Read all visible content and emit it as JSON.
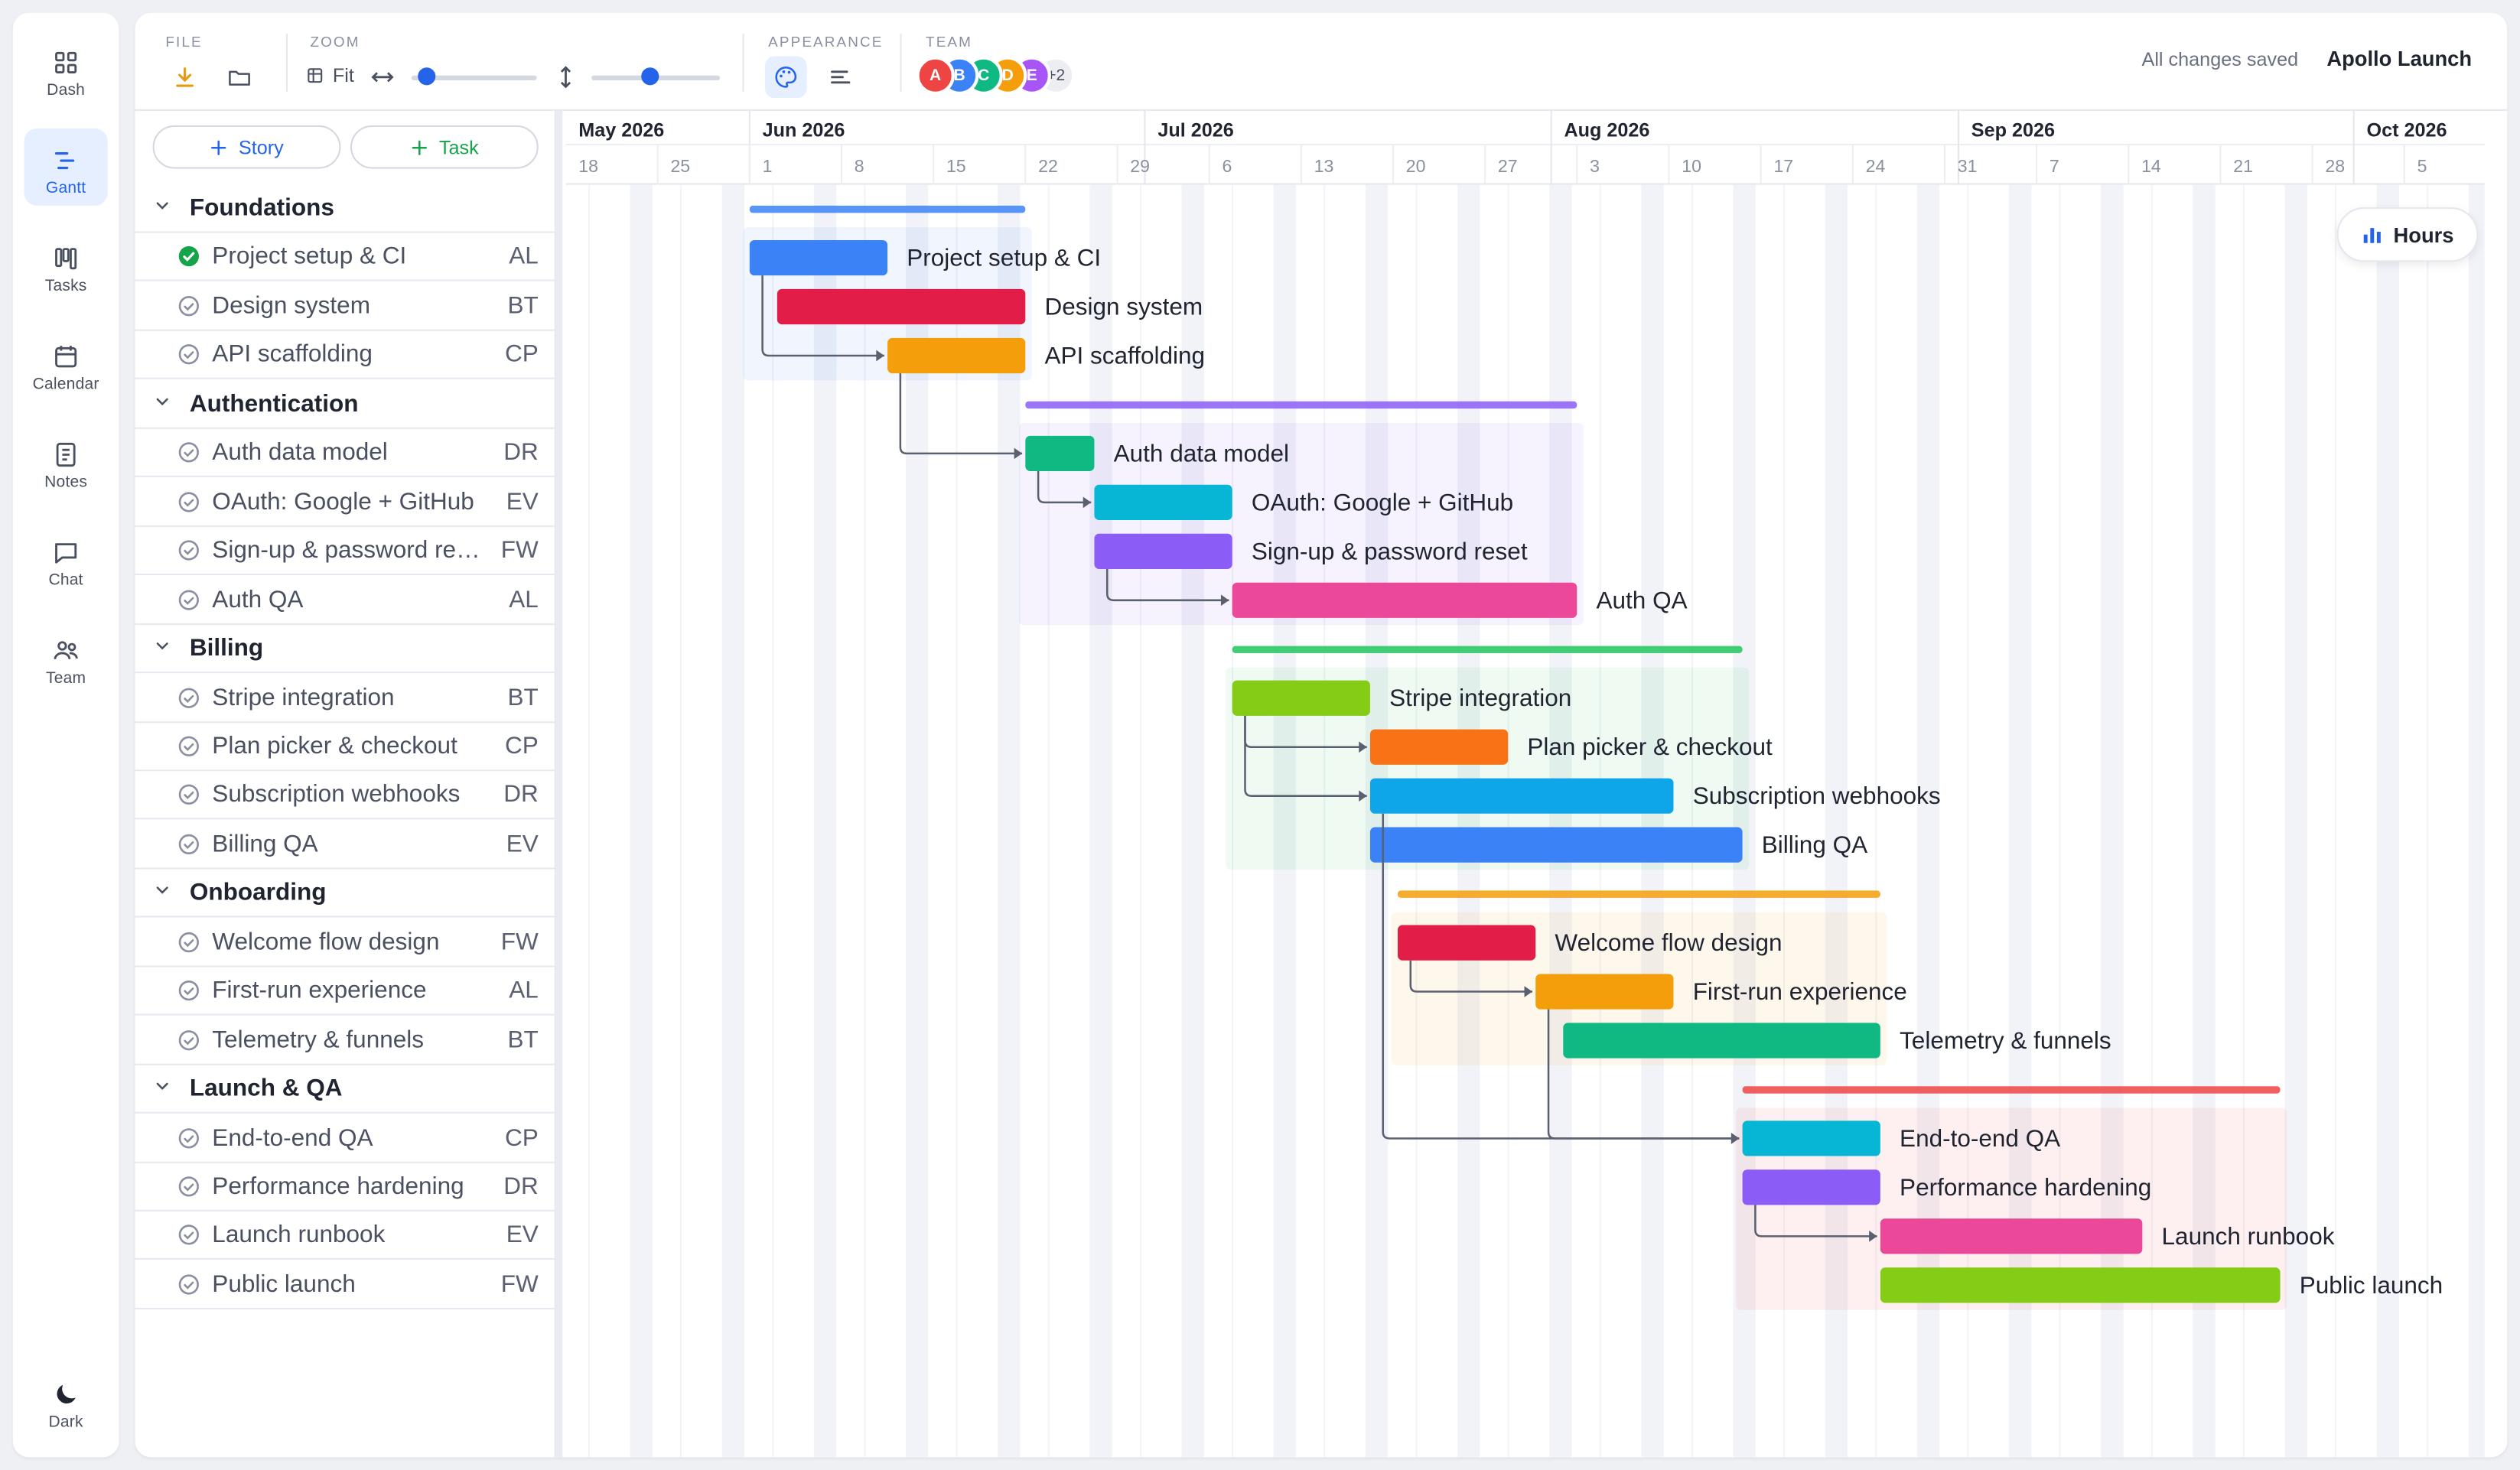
{
  "nav": [
    {
      "label": "Dash",
      "icon": "grid-icon",
      "active": false
    },
    {
      "label": "Gantt",
      "icon": "gantt-icon",
      "active": true
    },
    {
      "label": "Tasks",
      "icon": "kanban-icon",
      "active": false
    },
    {
      "label": "Calendar",
      "icon": "calendar-icon",
      "active": false
    },
    {
      "label": "Notes",
      "icon": "notes-icon",
      "active": false
    },
    {
      "label": "Chat",
      "icon": "chat-icon",
      "active": false
    },
    {
      "label": "Team",
      "icon": "team-icon",
      "active": false
    }
  ],
  "theme_toggle": {
    "label": "Dark",
    "icon": "moon-icon"
  },
  "toolbar": {
    "file_label": "FILE",
    "zoom_label": "ZOOM",
    "fit_label": "Fit",
    "appearance_label": "APPEARANCE",
    "team_label": "TEAM",
    "zoom_horizontal": 0.12,
    "zoom_vertical": 0.45,
    "team": [
      {
        "initial": "A",
        "color": "#ef4444"
      },
      {
        "initial": "B",
        "color": "#3b82f6"
      },
      {
        "initial": "C",
        "color": "#10b981"
      },
      {
        "initial": "D",
        "color": "#f59e0b"
      },
      {
        "initial": "E",
        "color": "#a855f7"
      }
    ],
    "team_more": "+2",
    "save_status": "All changes saved",
    "project_name": "Apollo Launch"
  },
  "list": {
    "add_story": "Story",
    "add_task": "Task"
  },
  "timeline": {
    "months": [
      "May 2026",
      "Jun 2026",
      "Jul 2026",
      "Aug 2026",
      "Sep 2026",
      "Oct 2026"
    ],
    "days": [
      "18",
      "25",
      "1",
      "8",
      "15",
      "22",
      "29",
      "6",
      "13",
      "20",
      "27",
      "3",
      "10",
      "17",
      "24",
      "31",
      "7",
      "14",
      "21",
      "28",
      "5"
    ],
    "hours_label": "Hours"
  },
  "groups": [
    {
      "name": "Foundations",
      "color": "#3b82f6",
      "tasks": [
        {
          "name": "Project setup & CI",
          "owner": "AL",
          "done": true,
          "color": "#3b82f6",
          "start": 2,
          "duration": 1.5
        },
        {
          "name": "Design system",
          "owner": "BT",
          "done": false,
          "color": "#e11d48",
          "start": 2.3,
          "duration": 2.7
        },
        {
          "name": "API scaffolding",
          "owner": "CP",
          "done": false,
          "color": "#f59e0b",
          "start": 3.5,
          "duration": 1.5
        }
      ]
    },
    {
      "name": "Authentication",
      "color": "#8b5cf6",
      "tasks": [
        {
          "name": "Auth data model",
          "owner": "DR",
          "done": false,
          "color": "#10b981",
          "start": 5,
          "duration": 0.75
        },
        {
          "name": "OAuth: Google + GitHub",
          "owner": "EV",
          "done": false,
          "color": "#06b6d4",
          "start": 5.75,
          "duration": 1.5
        },
        {
          "name": "Sign-up & password reset",
          "owner": "FW",
          "done": false,
          "color": "#8b5cf6",
          "start": 5.75,
          "duration": 1.5
        },
        {
          "name": "Auth QA",
          "owner": "AL",
          "done": false,
          "color": "#ec4899",
          "start": 7.25,
          "duration": 3.75
        }
      ]
    },
    {
      "name": "Billing",
      "color": "#22c55e",
      "tasks": [
        {
          "name": "Stripe integration",
          "owner": "BT",
          "done": false,
          "color": "#84cc16",
          "start": 7.25,
          "duration": 1.5
        },
        {
          "name": "Plan picker & checkout",
          "owner": "CP",
          "done": false,
          "color": "#f97316",
          "start": 8.75,
          "duration": 1.5
        },
        {
          "name": "Subscription webhooks",
          "owner": "DR",
          "done": false,
          "color": "#0ea5e9",
          "start": 8.75,
          "duration": 3.3
        },
        {
          "name": "Billing QA",
          "owner": "EV",
          "done": false,
          "color": "#3b82f6",
          "start": 8.75,
          "duration": 4.05
        }
      ]
    },
    {
      "name": "Onboarding",
      "color": "#f59e0b",
      "tasks": [
        {
          "name": "Welcome flow design",
          "owner": "FW",
          "done": false,
          "color": "#e11d48",
          "start": 9.05,
          "duration": 1.5
        },
        {
          "name": "First-run experience",
          "owner": "AL",
          "done": false,
          "color": "#f59e0b",
          "start": 10.55,
          "duration": 1.5
        },
        {
          "name": "Telemetry & funnels",
          "owner": "BT",
          "done": false,
          "color": "#10b981",
          "start": 10.85,
          "duration": 3.45
        }
      ]
    },
    {
      "name": "Launch & QA",
      "color": "#ef4444",
      "tasks": [
        {
          "name": "End-to-end QA",
          "owner": "CP",
          "done": false,
          "color": "#06b6d4",
          "start": 12.8,
          "duration": 1.5
        },
        {
          "name": "Performance hardening",
          "owner": "DR",
          "done": false,
          "color": "#8b5cf6",
          "start": 12.8,
          "duration": 1.5
        },
        {
          "name": "Launch runbook",
          "owner": "EV",
          "done": false,
          "color": "#ec4899",
          "start": 14.3,
          "duration": 2.85
        },
        {
          "name": "Public launch",
          "owner": "FW",
          "done": false,
          "color": "#84cc16",
          "start": 14.3,
          "duration": 4.35
        }
      ]
    }
  ],
  "dependencies": [
    {
      "from": "Project setup & CI",
      "to": "API scaffolding"
    },
    {
      "from": "API scaffolding",
      "to": "Auth data model"
    },
    {
      "from": "Auth data model",
      "to": "OAuth: Google + GitHub"
    },
    {
      "from": "Sign-up & password reset",
      "to": "Auth QA"
    },
    {
      "from": "Stripe integration",
      "to": "Plan picker & checkout"
    },
    {
      "from": "Stripe integration",
      "to": "Subscription webhooks"
    },
    {
      "from": "Welcome flow design",
      "to": "First-run experience"
    },
    {
      "from": "Subscription webhooks",
      "to": "End-to-end QA"
    },
    {
      "from": "First-run experience",
      "to": "End-to-end QA"
    },
    {
      "from": "Performance hardening",
      "to": "Launch runbook"
    }
  ]
}
